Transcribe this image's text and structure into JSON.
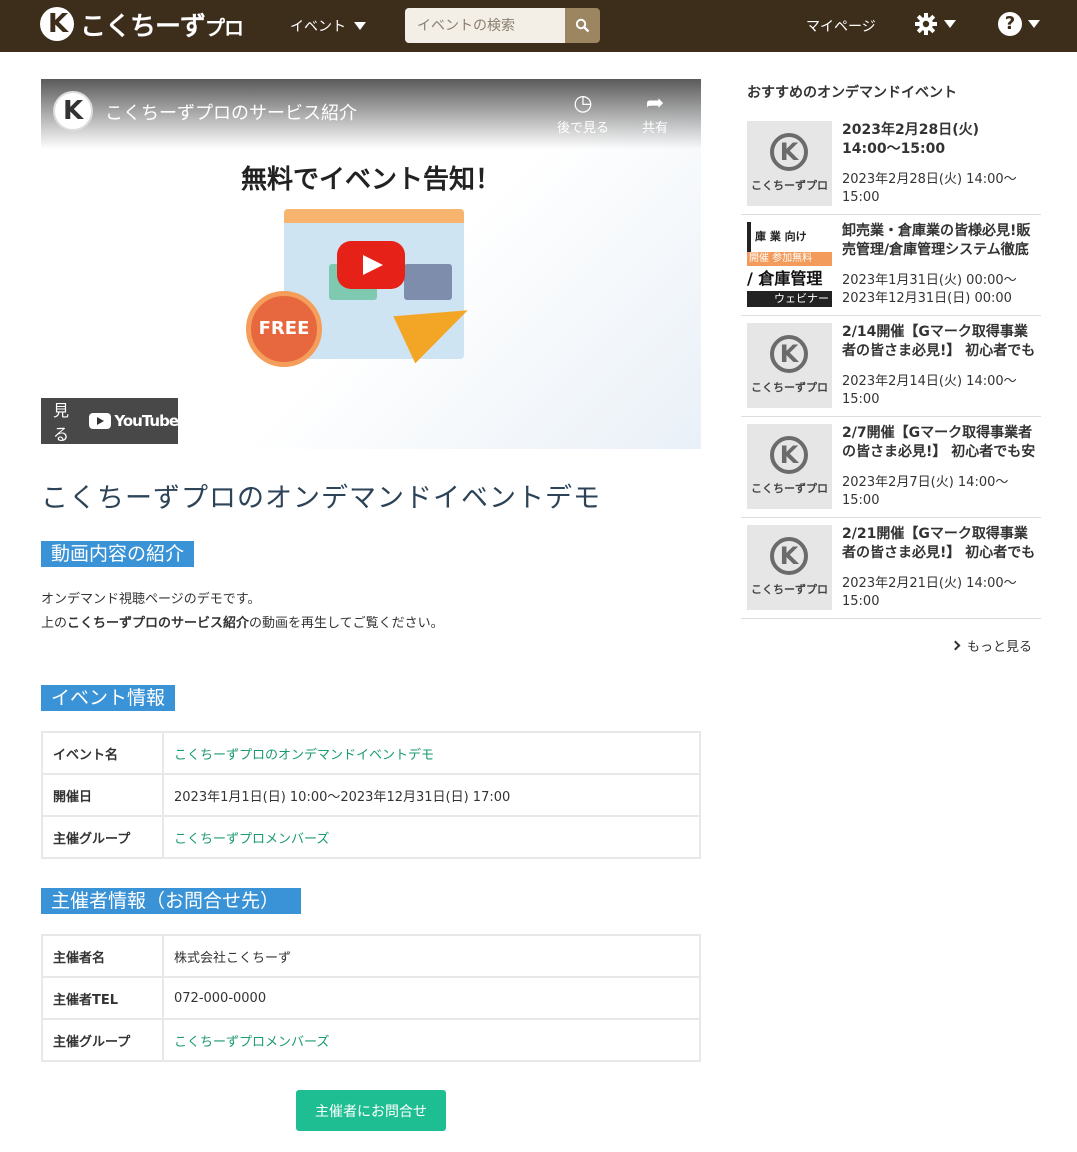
{
  "nav": {
    "logo_main": "こくちーず",
    "logo_sub": "プロ",
    "events_menu": "イベント",
    "search_placeholder": "イベントの検索",
    "mypage": "マイページ",
    "help_glyph": "?"
  },
  "video": {
    "title": "こくちーずプロのサービス紹介",
    "watch_later": "後で見る",
    "share": "共有",
    "headline": "無料でイベント告知！",
    "free_badge": "FREE",
    "watch_on": "見る",
    "youtube": "YouTube"
  },
  "main": {
    "title": "こくちーずプロのオンデマンドイベントデモ",
    "section_video": "動画内容の紹介",
    "desc_line1": "オンデマンド視聴ページのデモです。",
    "desc_line2_pre": "上の",
    "desc_line2_bold": "こくちーずプロのサービス紹介",
    "desc_line2_post": "の動画を再生してご覧ください。",
    "section_event": "イベント情報",
    "event_rows": [
      {
        "key": "イベント名",
        "value": "こくちーずプロのオンデマンドイベントデモ"
      },
      {
        "key": "開催日",
        "value": "2023年1月1日(日) 10:00〜2023年12月31日(日) 17:00"
      },
      {
        "key": "主催グループ",
        "value": "こくちーずプロメンバーズ"
      }
    ],
    "section_organizer": "主催者情報（お問合せ先）",
    "organizer_rows": [
      {
        "key": "主催者名",
        "value": "株式会社こくちーず"
      },
      {
        "key": "主催者TEL",
        "value": "072-000-0000"
      },
      {
        "key": "主催グループ",
        "value": "こくちーずプロメンバーズ"
      }
    ],
    "contact_button": "主催者にお問合せ"
  },
  "sidebar": {
    "title": "おすすめのオンデマンドイベント",
    "thumb_label": "こくちーずプロ",
    "banner": {
      "a": "庫 業 向け",
      "b": "開催 参加無料",
      "c": "/ 倉庫管理",
      "d": "ウェビナー"
    },
    "items": [
      {
        "title": "2023年2月28日(火) 14:00〜15:00",
        "date": "2023年2月28日(火) 14:00〜15:00"
      },
      {
        "title": "卸売業・倉庫業の皆様必見!販売管理/倉庫管理システム徹底",
        "date": "2023年1月31日(火) 00:00〜2023年12月31日(日) 00:00"
      },
      {
        "title": "2/14開催【Gマーク取得事業者の皆さま必見!】 初心者でも",
        "date": "2023年2月14日(火) 14:00〜15:00"
      },
      {
        "title": "2/7開催【Gマーク取得事業者の皆さま必見!】 初心者でも安",
        "date": "2023年2月7日(火) 14:00〜15:00"
      },
      {
        "title": "2/21開催【Gマーク取得事業者の皆さま必見!】 初心者でも",
        "date": "2023年2月21日(火) 14:00〜15:00"
      }
    ],
    "more": "もっと見る"
  },
  "colors": {
    "nav_bg": "#3d2e1b",
    "accent_section": "#3a93d6",
    "link": "#1a9a72",
    "button": "#1fbd92"
  }
}
